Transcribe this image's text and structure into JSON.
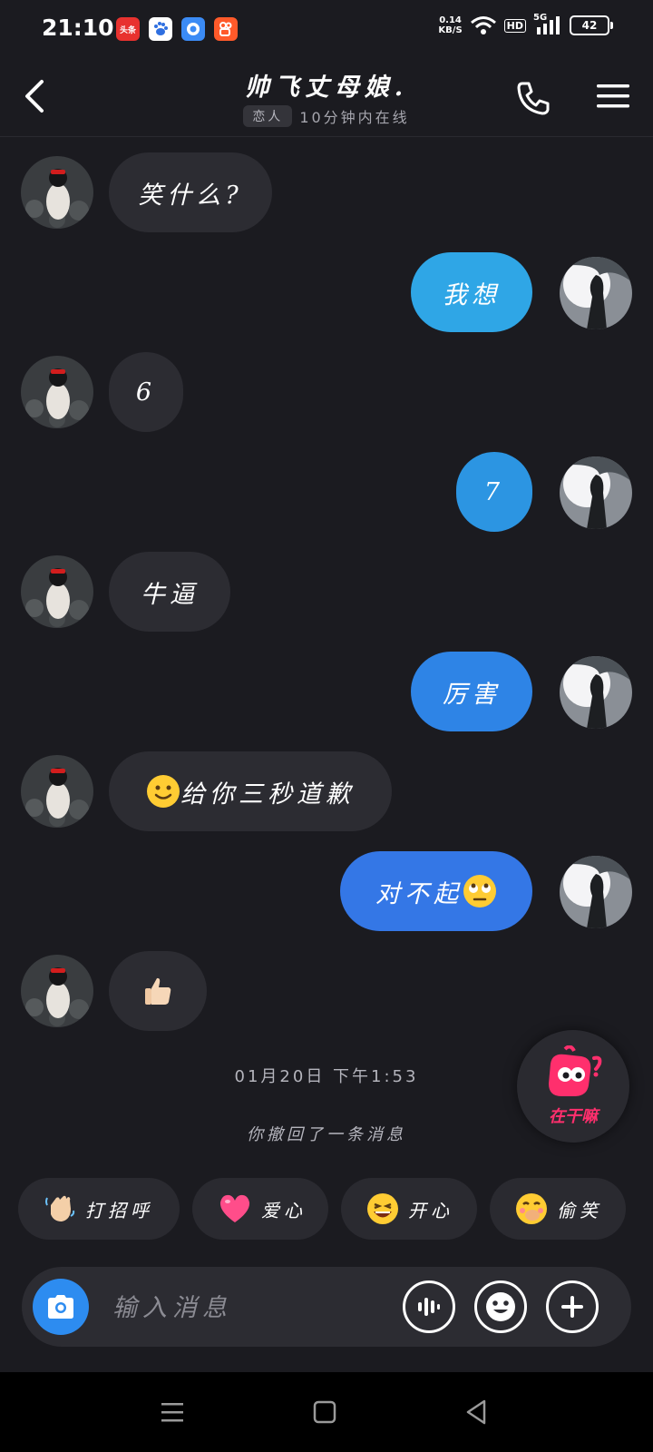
{
  "status_bar": {
    "time": "21:10",
    "apps": [
      {
        "name": "toutiao-app-icon",
        "label": "头条",
        "color": "#e8322f"
      },
      {
        "name": "baidu-app-icon",
        "label": "",
        "color": "#ffffff"
      },
      {
        "name": "browser-app-icon",
        "label": "",
        "color": "#3b8bf5"
      },
      {
        "name": "kuaishou-app-icon",
        "label": "",
        "color": "#ff5a2a"
      }
    ],
    "net_speed_value": "0.14",
    "net_speed_unit": "KB/S",
    "hd": "HD",
    "signal": "5G",
    "battery": "42"
  },
  "header": {
    "title": "帅飞丈母娘.",
    "tag": "恋人",
    "status": "10分钟内在线"
  },
  "messages": [
    {
      "side": "left",
      "text": "笑什么?"
    },
    {
      "side": "right",
      "text": "我想",
      "color": "#2fa6e6"
    },
    {
      "side": "left",
      "text": "6"
    },
    {
      "side": "right",
      "text": "7",
      "color": "#2c95e2"
    },
    {
      "side": "left",
      "text": "牛逼"
    },
    {
      "side": "right",
      "text": "厉害",
      "color": "#2e84e6"
    },
    {
      "side": "left",
      "text": "给你三秒道歉",
      "emoji": "slightly-smiling-emoji"
    },
    {
      "side": "right",
      "text": "对不起",
      "emoji": "eye-roll-emoji",
      "color": "#3477e6"
    },
    {
      "side": "left",
      "emoji": "thumbs-up-emoji"
    }
  ],
  "timestamp": "01月20日 下午1:53",
  "recall_notice": "你撤回了一条消息",
  "float_button": {
    "label": "在干嘛",
    "icon": "zaiganma-mascot-icon"
  },
  "quick_replies": [
    {
      "label": "打招呼",
      "icon": "waving-hand-icon"
    },
    {
      "label": "爱心",
      "icon": "heart-icon"
    },
    {
      "label": "开心",
      "icon": "laughing-face-icon"
    },
    {
      "label": "偷笑",
      "icon": "giggling-face-icon"
    }
  ],
  "input": {
    "placeholder": "输入消息",
    "value": ""
  },
  "colors": {
    "background": "#1b1b20",
    "bubble_incoming": "#2c2c32",
    "accent": "#2d8cf0",
    "float_label": "#ff2f6d"
  }
}
